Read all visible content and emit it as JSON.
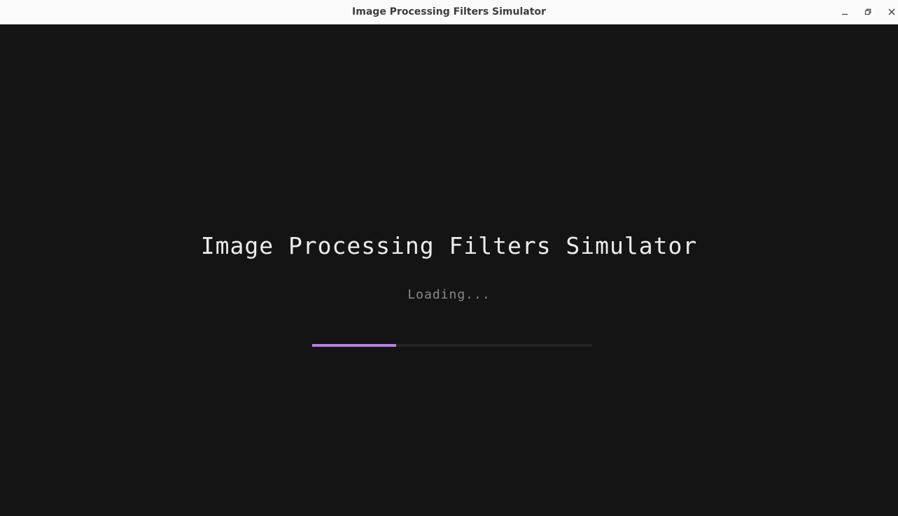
{
  "window": {
    "title": "Image Processing Filters Simulator",
    "controls": {
      "minimize_icon": "minimize-icon",
      "maximize_icon": "maximize-icon",
      "close_icon": "close-icon"
    }
  },
  "splash": {
    "title": "Image Processing Filters Simulator",
    "loading_text": "Loading...",
    "progress": 0.3
  },
  "colors": {
    "background": "#141414",
    "title_text": "#ececec",
    "loading_text": "#8a8a8a",
    "progress_track": "#242424",
    "progress_accent": "#b77ee8"
  }
}
